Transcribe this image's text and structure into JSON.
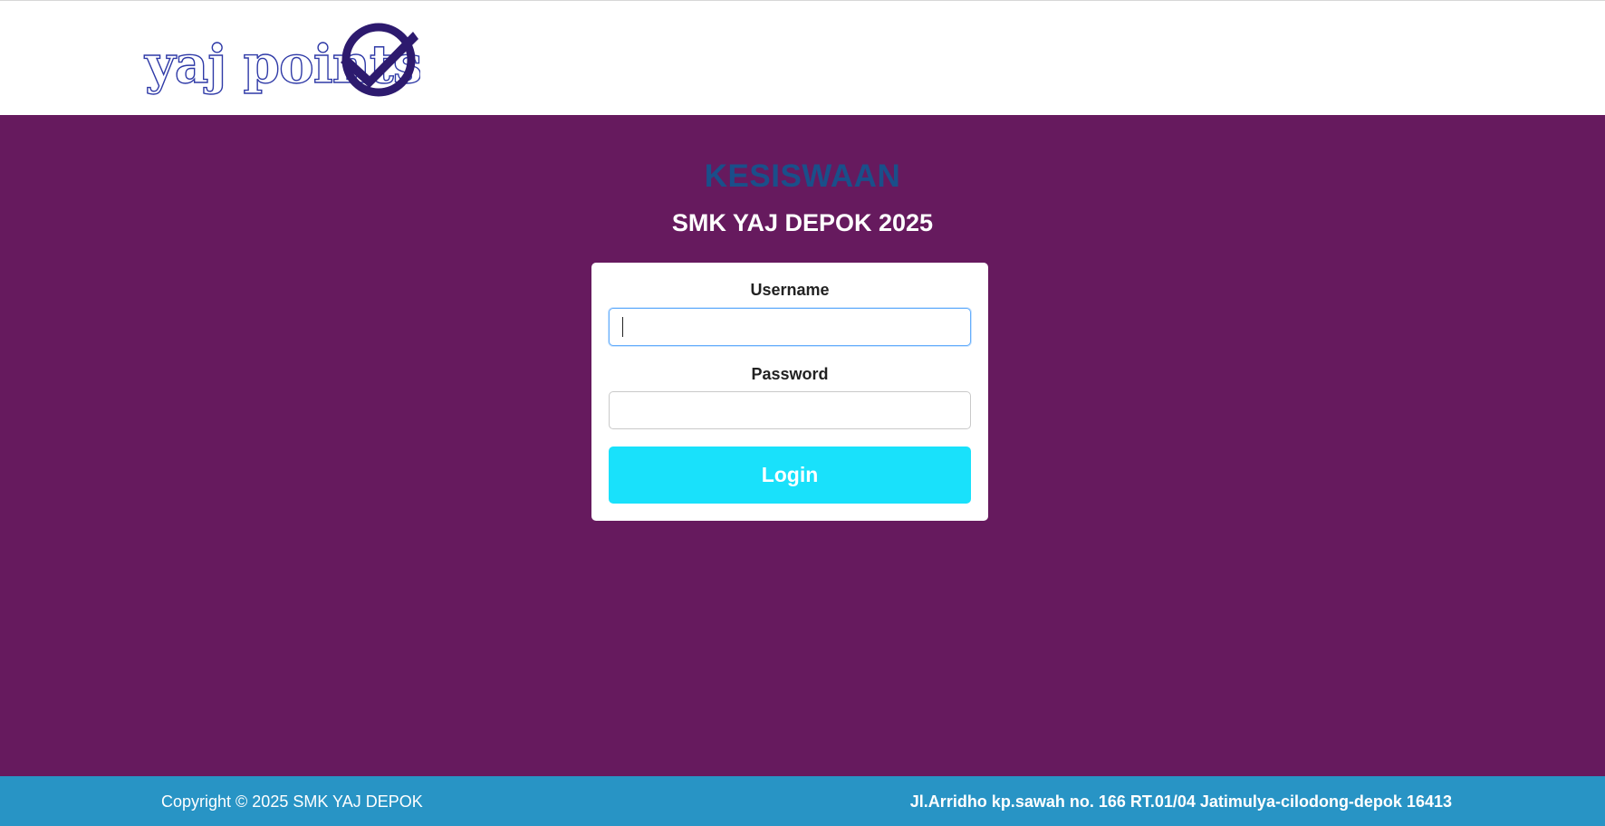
{
  "header": {
    "logo": {
      "text": "yaj points",
      "icon": "checkmark-circle-icon",
      "text_color": "#2f3aa7",
      "icon_color": "#2d1a6e"
    }
  },
  "main": {
    "title": "KESISWAAN",
    "subtitle": "SMK YAJ DEPOK 2025",
    "title_color": "#1a4f8a",
    "background_color": "#661a5e"
  },
  "login": {
    "username_label": "Username",
    "username_value": "",
    "password_label": "Password",
    "password_value": "",
    "button_label": "Login",
    "button_color": "#19e1fb"
  },
  "footer": {
    "copyright": "Copyright © 2025 SMK YAJ DEPOK",
    "address": "Jl.Arridho kp.sawah no. 166 RT.01/04 Jatimulya-cilodong-depok 16413",
    "background_color": "#2894c5"
  }
}
